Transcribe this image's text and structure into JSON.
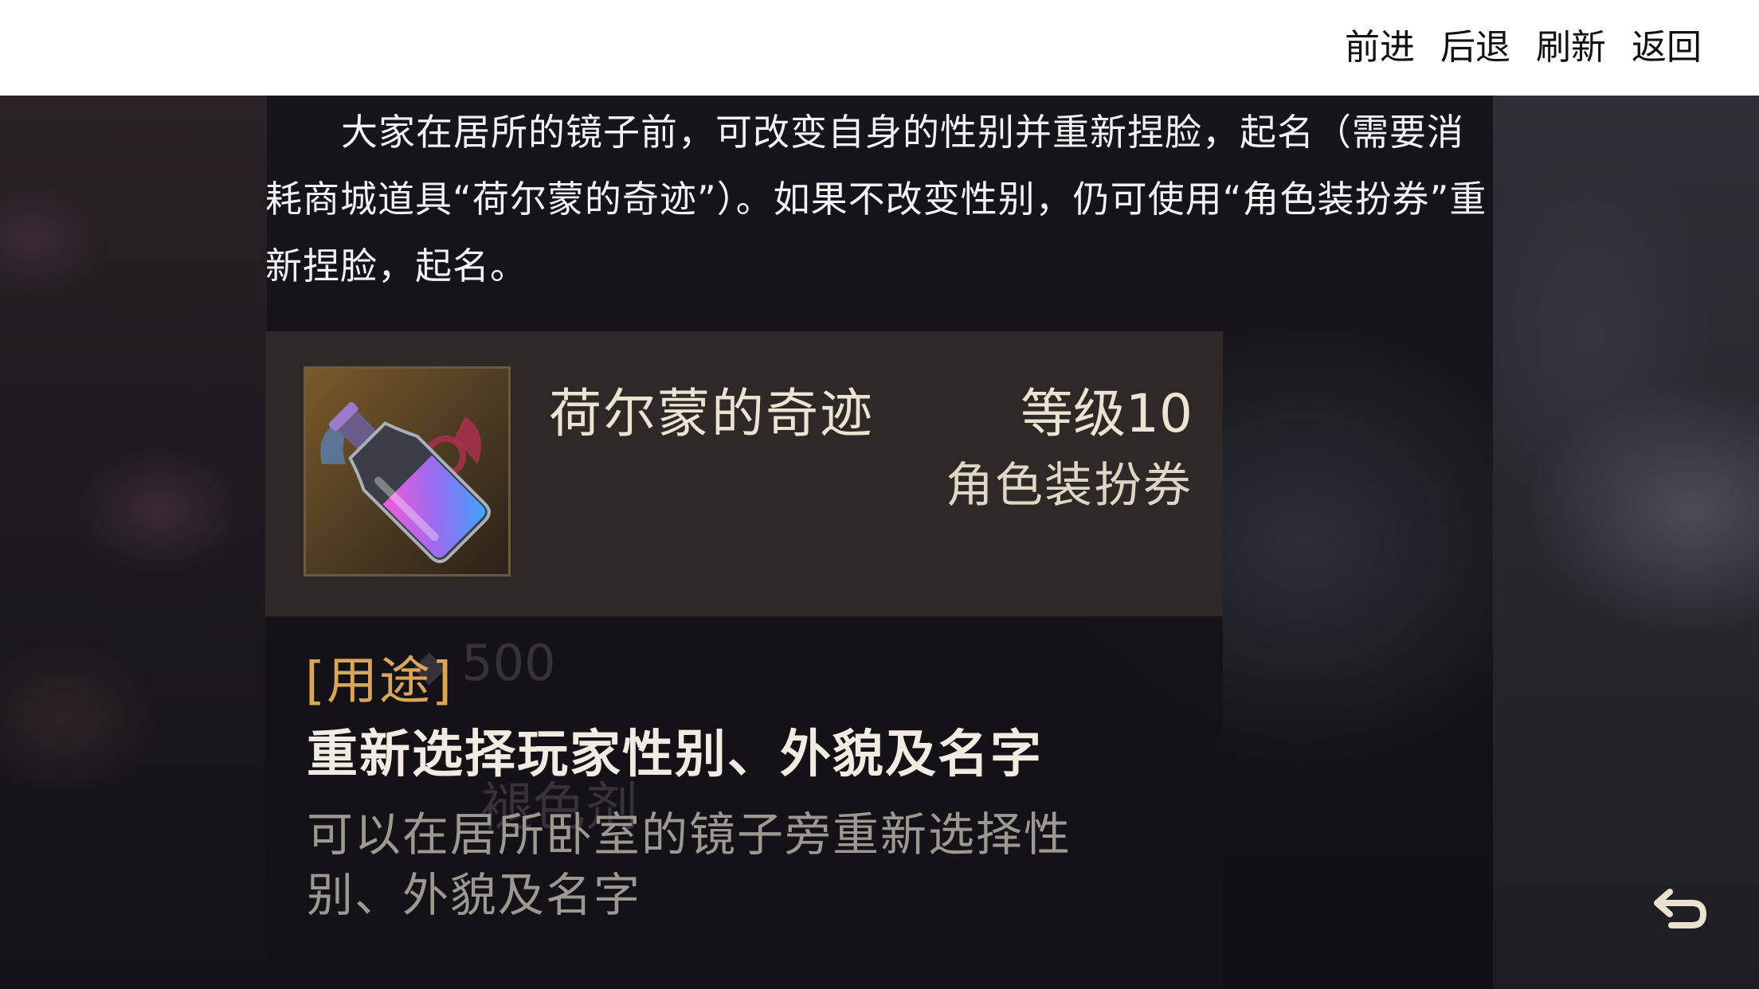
{
  "nav": {
    "forward": "前进",
    "back": "后退",
    "refresh": "刷新",
    "return": "返回"
  },
  "article": {
    "text": "大家在居所的镜子前，可改变自身的性别并重新捏脸，起名（需要消耗商城道具“荷尔蒙的奇迹”）。如果不改变性别，仍可使用“角色装扮券”重新捏脸，起名。"
  },
  "item": {
    "name": "荷尔蒙的奇迹",
    "level": "等级10",
    "type": "角色装扮券",
    "icon": "potion-bottle-icon"
  },
  "usage": {
    "label": "[用途]",
    "main": "重新选择玩家性别、外貌及名字",
    "description": "可以在居所卧室的镜子旁重新选择性别、外貌及名字"
  },
  "background": {
    "price": "500",
    "faded_label": "褪色剂"
  },
  "colors": {
    "nav_bg": "#ffffff",
    "usage_label": "#d9a55a",
    "card_bg": "#2e2926"
  }
}
